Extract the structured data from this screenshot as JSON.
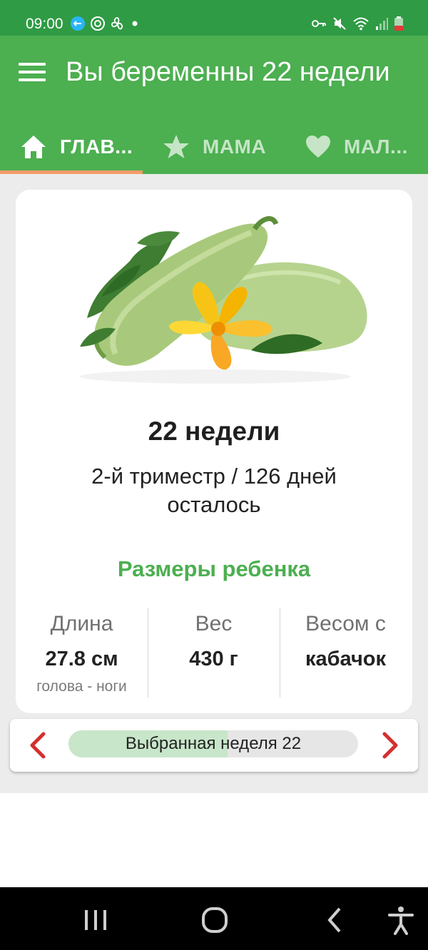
{
  "status_bar": {
    "time": "09:00",
    "left_icons": [
      "vpn-badge-icon",
      "target-icon",
      "fan-icon",
      "dot-icon"
    ],
    "right_icons": [
      "key-icon",
      "mute-icon",
      "wifi-icon",
      "signal-icon",
      "battery-icon"
    ],
    "battery_color": "#e53935"
  },
  "app_bar": {
    "title": "Вы беременны 22 недели",
    "background": "#4caf50"
  },
  "tabs": [
    {
      "label": "ГЛАВ...",
      "icon": "home-icon",
      "active": true
    },
    {
      "label": "МАМА",
      "icon": "star-icon",
      "active": false
    },
    {
      "label": "МАЛ...",
      "icon": "heart-icon",
      "active": false
    }
  ],
  "card": {
    "image": "zucchini-illustration",
    "week_title": "22 недели",
    "trimester_line": "2-й триместр / 126 дней осталось",
    "sizes_title": "Размеры ребенка",
    "metrics": [
      {
        "label": "Длина",
        "value": "27.8 см",
        "note": "голова - ноги"
      },
      {
        "label": "Вес",
        "value": "430 г",
        "note": ""
      },
      {
        "label": "Весом с",
        "value": "кабачок",
        "note": ""
      }
    ]
  },
  "week_selector": {
    "text": "Выбранная неделя 22",
    "progress_fraction": 0.55,
    "prev_icon": "chevron-left-icon",
    "next_icon": "chevron-right-icon",
    "arrow_color": "#d32f2f"
  },
  "nav_bar": {
    "buttons": [
      "recent-apps-icon",
      "home-circle-icon",
      "back-icon",
      "accessibility-icon"
    ]
  },
  "colors": {
    "accent": "#4caf50",
    "status_bar": "#2f9b44",
    "tab_indicator": "#f39c6b"
  }
}
